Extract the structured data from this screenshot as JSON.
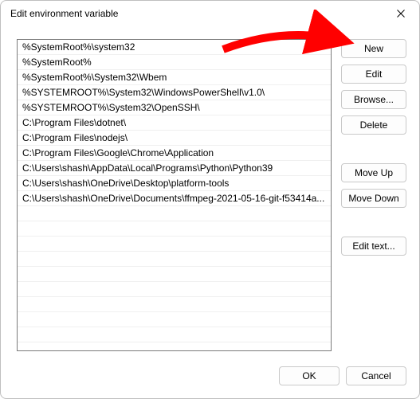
{
  "title": "Edit environment variable",
  "list_items": [
    "%SystemRoot%\\system32",
    "%SystemRoot%",
    "%SystemRoot%\\System32\\Wbem",
    "%SYSTEMROOT%\\System32\\WindowsPowerShell\\v1.0\\",
    "%SYSTEMROOT%\\System32\\OpenSSH\\",
    "C:\\Program Files\\dotnet\\",
    "C:\\Program Files\\nodejs\\",
    "C:\\Program Files\\Google\\Chrome\\Application",
    "C:\\Users\\shash\\AppData\\Local\\Programs\\Python\\Python39",
    "C:\\Users\\shash\\OneDrive\\Desktop\\platform-tools",
    "C:\\Users\\shash\\OneDrive\\Documents\\ffmpeg-2021-05-16-git-f53414a..."
  ],
  "buttons": {
    "new": "New",
    "edit": "Edit",
    "browse": "Browse...",
    "delete": "Delete",
    "move_up": "Move Up",
    "move_down": "Move Down",
    "edit_text": "Edit text..."
  },
  "footer": {
    "ok": "OK",
    "cancel": "Cancel"
  },
  "annotation": {
    "arrow_color": "#ff0000",
    "arrow_target": "new-button"
  }
}
